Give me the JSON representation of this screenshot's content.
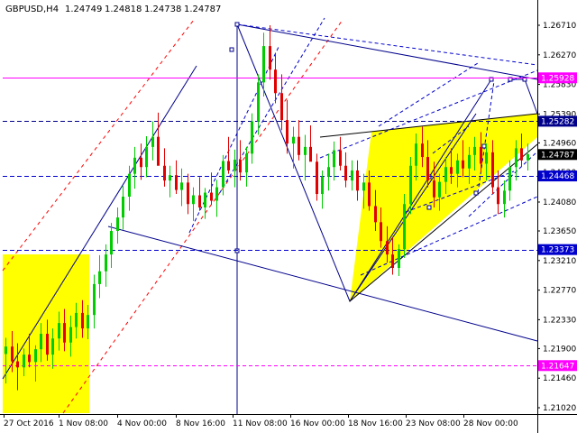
{
  "chart_data": {
    "type": "candlestick",
    "title": {
      "symbol": "GBPUSD,H4",
      "open": "1.24749",
      "high": "1.24818",
      "low": "1.24738",
      "close": "1.24787"
    },
    "y_ticks": [
      "1.26710",
      "1.26270",
      "1.25830",
      "1.25390",
      "1.24960",
      "1.24520",
      "1.24080",
      "1.23650",
      "1.23210",
      "1.22770",
      "1.22330",
      "1.21900",
      "1.21460",
      "1.21020"
    ],
    "x_ticks": [
      "27 Oct 2016",
      "1 Nov 08:00",
      "4 Nov 00:00",
      "8 Nov 16:00",
      "11 Nov 08:00",
      "16 Nov 00:00",
      "18 Nov 16:00",
      "23 Nov 08:00",
      "28 Nov 00:00"
    ],
    "ylim": [
      1.209,
      1.2695
    ],
    "price_labels": [
      {
        "text": "1.25928",
        "value": 1.25928,
        "color": "#ff00ff",
        "bg": "#ff00ff"
      },
      {
        "text": "1.25282",
        "value": 1.25282,
        "color": "#00008b",
        "bg": "#00008b"
      },
      {
        "text": "1.24787",
        "value": 1.24787,
        "color": "#000000",
        "bg": "#000000"
      },
      {
        "text": "1.24468",
        "value": 1.24468,
        "color": "#0000cd",
        "bg": "#0000cd"
      },
      {
        "text": "1.23373",
        "value": 1.23373,
        "color": "#0000cd",
        "bg": "#0000cd"
      },
      {
        "text": "1.21647",
        "value": 1.21647,
        "color": "#ff00ff",
        "bg": "#ff00ff"
      }
    ],
    "grid": false,
    "colors": {
      "bull": "#00cc00",
      "bear": "#e00000",
      "highlight": "#ffff00",
      "line": "#00008b",
      "dashed": "#0000cd",
      "magenta": "#ff00ff",
      "red_dashed": "#ff0000"
    },
    "candles_ohlc": [
      [
        1.2182,
        1.2206,
        1.2138,
        1.2193
      ],
      [
        1.2193,
        1.2216,
        1.2155,
        1.2171
      ],
      [
        1.2171,
        1.2198,
        1.2128,
        1.2162
      ],
      [
        1.2162,
        1.219,
        1.2149,
        1.2181
      ],
      [
        1.2181,
        1.2212,
        1.2162,
        1.217
      ],
      [
        1.217,
        1.2195,
        1.2141,
        1.2189
      ],
      [
        1.2189,
        1.2228,
        1.217,
        1.2212
      ],
      [
        1.2212,
        1.2233,
        1.2172,
        1.2181
      ],
      [
        1.2181,
        1.222,
        1.216,
        1.2205
      ],
      [
        1.2205,
        1.2245,
        1.2187,
        1.2228
      ],
      [
        1.2228,
        1.2249,
        1.2186,
        1.2199
      ],
      [
        1.2199,
        1.2239,
        1.2178,
        1.2222
      ],
      [
        1.2222,
        1.2258,
        1.2205,
        1.2243
      ],
      [
        1.2243,
        1.2262,
        1.2206,
        1.222
      ],
      [
        1.222,
        1.2255,
        1.2204,
        1.224
      ],
      [
        1.224,
        1.23,
        1.222,
        1.2286
      ],
      [
        1.2286,
        1.2329,
        1.2265,
        1.2305
      ],
      [
        1.2305,
        1.2345,
        1.2282,
        1.233
      ],
      [
        1.233,
        1.2377,
        1.231,
        1.2365
      ],
      [
        1.2365,
        1.24,
        1.2346,
        1.2385
      ],
      [
        1.2385,
        1.2432,
        1.2367,
        1.2416
      ],
      [
        1.2416,
        1.2462,
        1.2395,
        1.245
      ],
      [
        1.245,
        1.249,
        1.2428,
        1.2474
      ],
      [
        1.2474,
        1.2495,
        1.2441,
        1.246
      ],
      [
        1.246,
        1.2506,
        1.2445,
        1.249
      ],
      [
        1.249,
        1.2528,
        1.247,
        1.2505
      ],
      [
        1.2505,
        1.2541,
        1.248,
        1.2462
      ],
      [
        1.2462,
        1.2488,
        1.2431,
        1.244
      ],
      [
        1.244,
        1.2462,
        1.2415,
        1.2448
      ],
      [
        1.2448,
        1.247,
        1.242,
        1.2426
      ],
      [
        1.2426,
        1.2458,
        1.2402,
        1.2437
      ],
      [
        1.2437,
        1.245,
        1.239,
        1.2405
      ],
      [
        1.2405,
        1.243,
        1.238,
        1.2418
      ],
      [
        1.2418,
        1.2445,
        1.2395,
        1.24
      ],
      [
        1.24,
        1.2429,
        1.2383,
        1.2422
      ],
      [
        1.2422,
        1.2452,
        1.2404,
        1.241
      ],
      [
        1.241,
        1.2441,
        1.2386,
        1.243
      ],
      [
        1.243,
        1.2478,
        1.2418,
        1.2469
      ],
      [
        1.2469,
        1.2505,
        1.245,
        1.2455
      ],
      [
        1.2455,
        1.2486,
        1.243,
        1.2471
      ],
      [
        1.2471,
        1.25,
        1.244,
        1.2452
      ],
      [
        1.2452,
        1.249,
        1.2431,
        1.248
      ],
      [
        1.248,
        1.254,
        1.2465,
        1.2528
      ],
      [
        1.2528,
        1.2598,
        1.2508,
        1.2586
      ],
      [
        1.2586,
        1.266,
        1.2565,
        1.264
      ],
      [
        1.264,
        1.2671,
        1.259,
        1.2605
      ],
      [
        1.2605,
        1.263,
        1.2555,
        1.257
      ],
      [
        1.257,
        1.2598,
        1.2515,
        1.253
      ],
      [
        1.253,
        1.256,
        1.248,
        1.2495
      ],
      [
        1.2495,
        1.252,
        1.2458,
        1.2505
      ],
      [
        1.2505,
        1.253,
        1.247,
        1.2478
      ],
      [
        1.2478,
        1.2508,
        1.244,
        1.249
      ],
      [
        1.249,
        1.2522,
        1.247,
        1.2468
      ],
      [
        1.2468,
        1.248,
        1.241,
        1.242
      ],
      [
        1.242,
        1.2455,
        1.2398,
        1.2446
      ],
      [
        1.2446,
        1.248,
        1.2425,
        1.246
      ],
      [
        1.246,
        1.2498,
        1.244,
        1.2485
      ],
      [
        1.2485,
        1.2505,
        1.2455,
        1.2462
      ],
      [
        1.2462,
        1.2482,
        1.243,
        1.244
      ],
      [
        1.244,
        1.247,
        1.2425,
        1.2455
      ],
      [
        1.2455,
        1.247,
        1.241,
        1.2425
      ],
      [
        1.2425,
        1.245,
        1.2398,
        1.2437
      ],
      [
        1.2437,
        1.2455,
        1.2395,
        1.2402
      ],
      [
        1.2402,
        1.2426,
        1.2365,
        1.2378
      ],
      [
        1.2378,
        1.24,
        1.234,
        1.235
      ],
      [
        1.235,
        1.2372,
        1.2318,
        1.233
      ],
      [
        1.233,
        1.2355,
        1.23,
        1.231
      ],
      [
        1.231,
        1.2345,
        1.2298,
        1.2338
      ],
      [
        1.2338,
        1.242,
        1.2325,
        1.2405
      ],
      [
        1.2405,
        1.2475,
        1.239,
        1.2462
      ],
      [
        1.2462,
        1.251,
        1.244,
        1.2495
      ],
      [
        1.2495,
        1.252,
        1.246,
        1.2475
      ],
      [
        1.2475,
        1.25,
        1.243,
        1.244
      ],
      [
        1.244,
        1.2468,
        1.24,
        1.2415
      ],
      [
        1.2415,
        1.245,
        1.2395,
        1.2438
      ],
      [
        1.2438,
        1.2475,
        1.242,
        1.246
      ],
      [
        1.246,
        1.2488,
        1.2435,
        1.245
      ],
      [
        1.245,
        1.248,
        1.243,
        1.247
      ],
      [
        1.247,
        1.25,
        1.2445,
        1.2458
      ],
      [
        1.2458,
        1.249,
        1.2435,
        1.2478
      ],
      [
        1.2478,
        1.2505,
        1.2455,
        1.249
      ],
      [
        1.249,
        1.2512,
        1.2452,
        1.2465
      ],
      [
        1.2465,
        1.2495,
        1.244,
        1.2482
      ],
      [
        1.2482,
        1.25,
        1.242,
        1.243
      ],
      [
        1.243,
        1.2455,
        1.239,
        1.2405
      ],
      [
        1.2405,
        1.244,
        1.2385,
        1.2425
      ],
      [
        1.2425,
        1.247,
        1.241,
        1.246
      ],
      [
        1.246,
        1.25,
        1.244,
        1.2488
      ],
      [
        1.2488,
        1.251,
        1.246,
        1.247
      ],
      [
        1.247,
        1.2495,
        1.2455,
        1.2479
      ]
    ]
  }
}
